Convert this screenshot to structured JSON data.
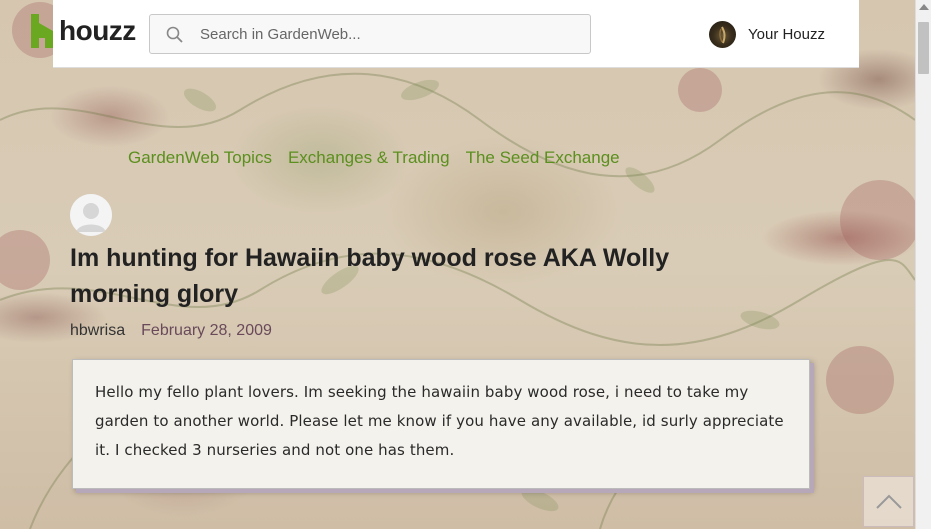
{
  "header": {
    "logo_text": "houzz",
    "search": {
      "placeholder": "Search in GardenWeb..."
    },
    "user_label": "Your Houzz"
  },
  "breadcrumb": [
    "GardenWeb Topics",
    "Exchanges & Trading",
    "The Seed Exchange"
  ],
  "post": {
    "title": "Im hunting for Hawaiin baby wood rose AKA Wolly morning glory",
    "author": "hbwrisa",
    "date": "February 28, 2009",
    "body": "Hello my fello plant lovers. Im seeking the hawaiin baby wood rose, i need to take my garden to another world. Please let me know if you have any available, id surly appreciate it. I checked 3 nurseries and not one has them."
  },
  "colors": {
    "brand_green": "#5b8f1e",
    "link_green": "#5b8f1e",
    "date_color": "#6a4a5a"
  },
  "icons": {
    "logo": "houzz-logo-icon",
    "search": "search-icon",
    "back_to_top": "chevron-up-icon"
  }
}
